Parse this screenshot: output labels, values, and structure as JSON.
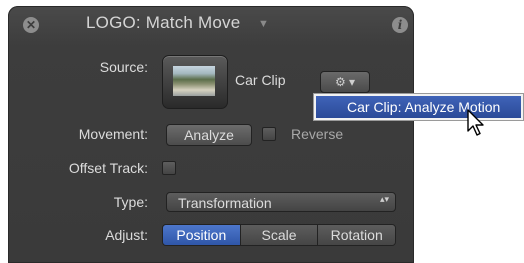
{
  "header": {
    "title": "LOGO: Match Move",
    "close_glyph": "✕",
    "info_glyph": "i",
    "caret_glyph": "▼",
    "close_icon": "close-icon",
    "info_icon": "info-icon"
  },
  "source": {
    "label": "Source:",
    "clip_name": "Car Clip",
    "gear_glyph": "⚙ ▾",
    "thumbnail_icon": "clip-thumbnail"
  },
  "menu": {
    "items": [
      {
        "label": "Car Clip: Analyze Motion",
        "selected": true
      }
    ]
  },
  "movement": {
    "label": "Movement:",
    "analyze_label": "Analyze",
    "reverse_label": "Reverse",
    "reverse_checked": false
  },
  "offset_track": {
    "label": "Offset Track:",
    "checked": false
  },
  "type": {
    "label": "Type:",
    "value": "Transformation",
    "arrows_glyph": "▴▾"
  },
  "adjust": {
    "label": "Adjust:",
    "segments": [
      "Position",
      "Scale",
      "Rotation"
    ],
    "selected": "Position"
  },
  "colors": {
    "panel_bg": "#3c3c3c",
    "accent_blue": "#2f56a8",
    "text": "#dcdcdc"
  }
}
